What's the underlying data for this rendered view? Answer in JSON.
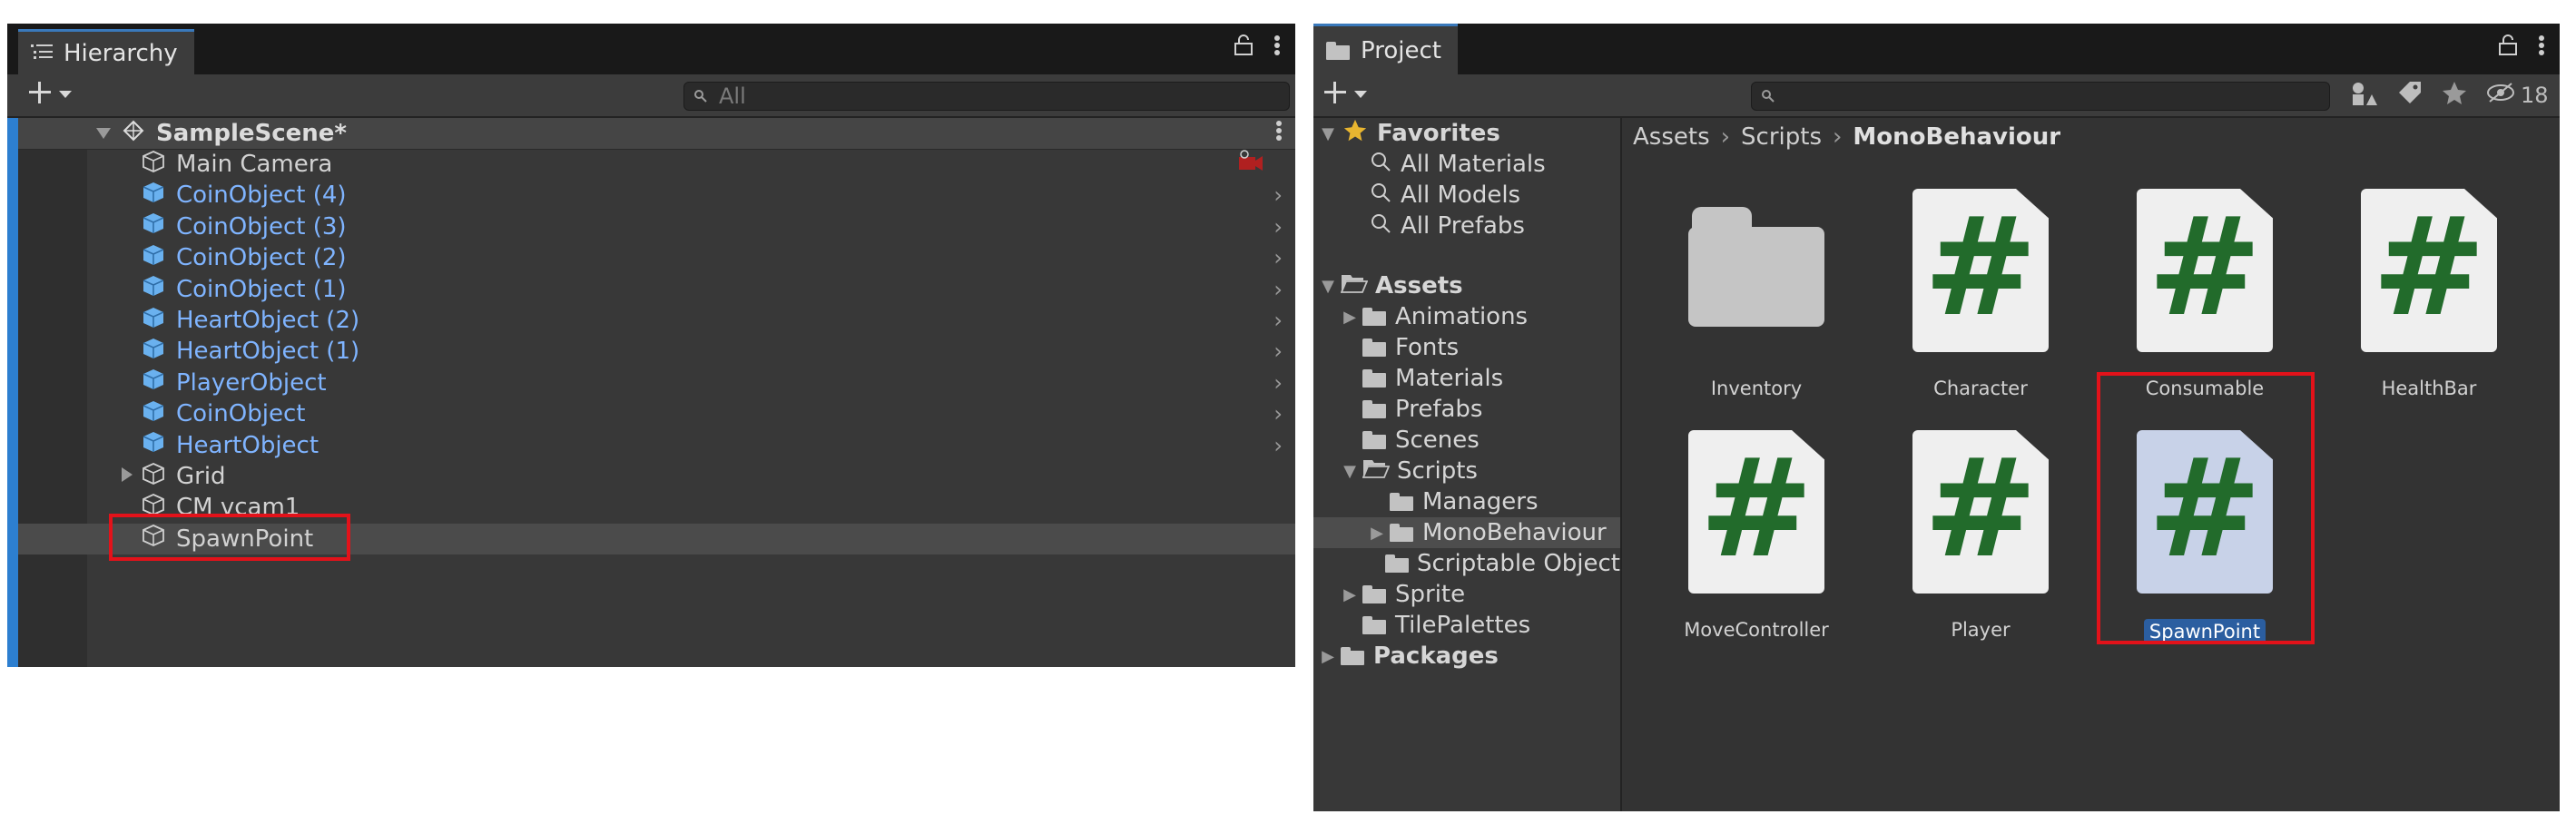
{
  "hierarchy": {
    "tab_label": "Hierarchy",
    "search_placeholder": "All",
    "scene_name": "SampleScene*",
    "rows": [
      {
        "label": "Main Camera",
        "prefab": false
      },
      {
        "label": "CoinObject (4)",
        "prefab": true
      },
      {
        "label": "CoinObject (3)",
        "prefab": true
      },
      {
        "label": "CoinObject (2)",
        "prefab": true
      },
      {
        "label": "CoinObject (1)",
        "prefab": true
      },
      {
        "label": "HeartObject (2)",
        "prefab": true
      },
      {
        "label": "HeartObject (1)",
        "prefab": true
      },
      {
        "label": "PlayerObject",
        "prefab": true
      },
      {
        "label": "CoinObject",
        "prefab": true
      },
      {
        "label": "HeartObject",
        "prefab": true
      },
      {
        "label": "Grid",
        "prefab": false
      },
      {
        "label": "CM vcam1",
        "prefab": false
      },
      {
        "label": "SpawnPoint",
        "prefab": false
      }
    ]
  },
  "project": {
    "tab_label": "Project",
    "hidden_count": "18",
    "tree": {
      "favorites": "Favorites",
      "fav_items": [
        "All Materials",
        "All Models",
        "All Prefabs"
      ],
      "assets": "Assets",
      "asset_items": [
        "Animations",
        "Fonts",
        "Materials",
        "Prefabs",
        "Scenes",
        "Scripts"
      ],
      "script_items": [
        "Managers",
        "MonoBehaviour",
        "Scriptable Object"
      ],
      "after_items": [
        "Sprite",
        "TilePalettes"
      ],
      "packages": "Packages"
    },
    "breadcrumb": [
      "Assets",
      "Scripts",
      "MonoBehaviour"
    ],
    "assets": [
      "Inventory",
      "Character",
      "Consumable",
      "HealthBar",
      "MoveController",
      "Player",
      "SpawnPoint"
    ]
  },
  "colors": {
    "prefab_text": "#7fb4ff",
    "highlight_box": "#e3121a",
    "script_hash": "#226b2b",
    "selection": "#2b5ea0"
  }
}
